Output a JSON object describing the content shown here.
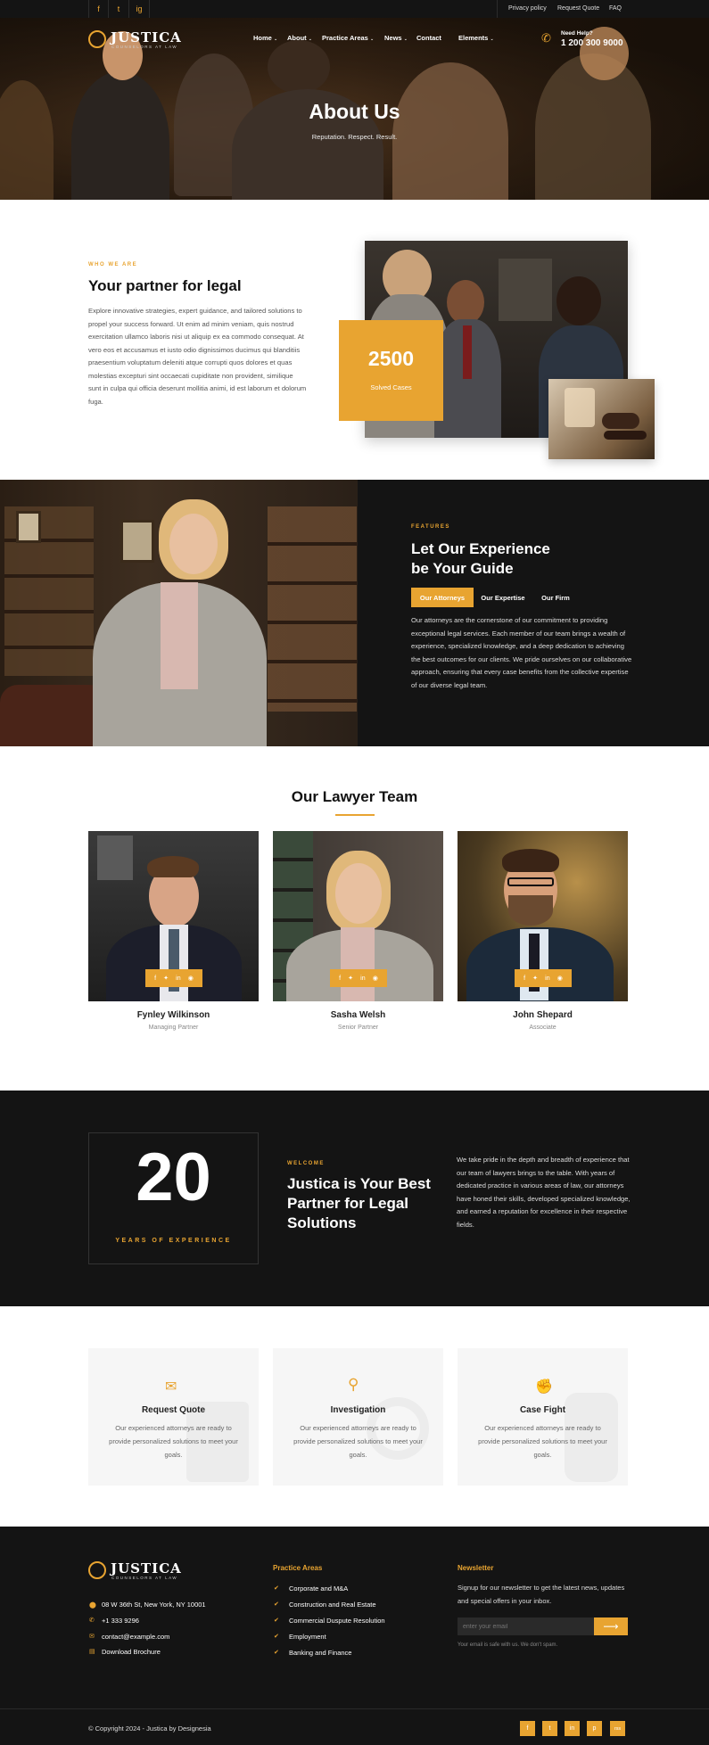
{
  "topbar": {
    "social": [
      "f",
      "t",
      "ig"
    ],
    "links": [
      "Privacy policy",
      "Request Quote",
      "FAQ"
    ]
  },
  "brand": {
    "name": "JUSTICA",
    "tagline": "COUNSELORS AT LAW"
  },
  "nav": {
    "items": [
      "Home",
      "About",
      "Practice Areas",
      "News",
      "Contact",
      "Elements"
    ],
    "help_label": "Need Help?",
    "phone": "1 200 300 9000"
  },
  "hero": {
    "title": "About Us",
    "subtitle": "Reputation. Respect. Result."
  },
  "about": {
    "eyebrow": "WHO WE ARE",
    "title": "Your partner for legal",
    "body": "Explore innovative strategies, expert guidance, and tailored solutions to propel your success forward. Ut enim ad minim veniam, quis nostrud exercitation ullamco laboris nisi ut aliquip ex ea commodo consequat. At vero eos et accusamus et iusto odio dignissimos ducimus qui blanditiis praesentium voluptatum deleniti atque corrupti quos dolores et quas molestias excepturi sint occaecati cupiditate non provident, similique sunt in culpa qui officia deserunt mollitia animi, id est laborum et dolorum fuga.",
    "stat_value": "2500",
    "stat_label": "Solved Cases"
  },
  "experience": {
    "eyebrow": "FEATURES",
    "title_line1": "Let Our Experience",
    "title_line2": "be Your Guide",
    "tabs": [
      "Our Attorneys",
      "Our Expertise",
      "Our Firm"
    ],
    "active_tab": 0,
    "body": "Our attorneys are the cornerstone of our commitment to providing exceptional legal services. Each member of our team brings a wealth of experience, specialized knowledge, and a deep dedication to achieving the best outcomes for our clients. We pride ourselves on our collaborative approach, ensuring that every case benefits from the collective expertise of our diverse legal team."
  },
  "team": {
    "title": "Our Lawyer Team",
    "members": [
      {
        "name": "Fynley Wilkinson",
        "role": "Managing Partner"
      },
      {
        "name": "Sasha Welsh",
        "role": "Senior Partner"
      },
      {
        "name": "John Shepard",
        "role": "Associate"
      }
    ]
  },
  "welcome": {
    "years": "20",
    "years_label": "YEARS OF EXPERIENCE",
    "eyebrow": "WELCOME",
    "title_line1": "Justica is Your Best",
    "title_line2": "Partner for Legal",
    "title_line3": "Solutions",
    "body": "We take pride in the depth and breadth of experience that our team of lawyers brings to the table. With years of dedicated practice in various areas of law, our attorneys have honed their skills, developed specialized knowledge, and earned a reputation for excellence in their respective fields."
  },
  "services": [
    {
      "icon": "document-icon",
      "title": "Request Quote",
      "text": "Our experienced attorneys are ready to provide personalized solutions to meet your goals."
    },
    {
      "icon": "magnifier-icon",
      "title": "Investigation",
      "text": "Our experienced attorneys are ready to provide personalized solutions to meet your goals."
    },
    {
      "icon": "fist-icon",
      "title": "Case Fight",
      "text": "Our experienced attorneys are ready to provide personalized solutions to meet your goals."
    }
  ],
  "footer": {
    "contact": [
      "08 W 36th St, New York, NY 10001",
      "+1 333 9296",
      "contact@example.com",
      "Download Brochure"
    ],
    "practice_title": "Practice Areas",
    "practice": [
      "Corporate and M&A",
      "Construction and Real Estate",
      "Commercial Duspute Resolution",
      "Employment",
      "Banking and Finance"
    ],
    "newsletter_title": "Newsletter",
    "newsletter_text": "Signup for our newsletter to get the latest news, updates and special offers in your inbox.",
    "email_placeholder": "enter your email",
    "email_note": "Your email is safe with us. We don't spam.",
    "copyright": "© Copyright 2024 - Justica by Designesia",
    "social": [
      "f",
      "t",
      "in",
      "p",
      "rss"
    ]
  },
  "colors": {
    "accent": "#e8a431",
    "dark": "#141414"
  }
}
